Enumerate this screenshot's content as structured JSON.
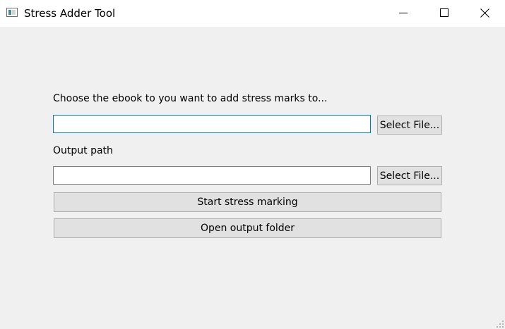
{
  "window": {
    "title": "Stress Adder Tool"
  },
  "form": {
    "ebook_label": "Choose the ebook to you want to add stress marks to...",
    "ebook_value": "",
    "select_file_label": "Select File...",
    "output_label": "Output path",
    "output_value": "",
    "select_output_label": "Select File...",
    "start_label": "Start stress marking",
    "open_output_label": "Open output folder"
  },
  "colors": {
    "window_bg": "#f0f0f0",
    "titlebar_bg": "#ffffff",
    "button_bg": "#e1e1e1",
    "button_border": "#adadad",
    "focus_border": "#0078d7"
  }
}
